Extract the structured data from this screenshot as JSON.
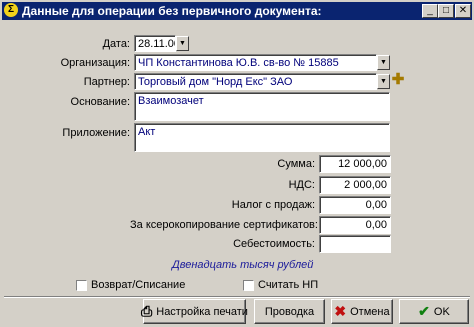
{
  "window": {
    "title": "Данные для операции без первичного документа:",
    "buttons": {
      "minimize": "_",
      "maximize": "□",
      "close": "✕"
    }
  },
  "form": {
    "date": {
      "label": "Дата:",
      "value": "28.11.00"
    },
    "organization": {
      "label": "Организация:",
      "value": "ЧП Константинова Ю.В. св-во № 15885"
    },
    "partner": {
      "label": "Партнер:",
      "value": "Торговый дом \"Норд Екс\" ЗАО"
    },
    "basis": {
      "label": "Основание:",
      "value": "Взаимозачет"
    },
    "attachment": {
      "label": "Приложение:",
      "value": "Акт"
    },
    "sum": {
      "label": "Сумма:",
      "value": "12 000,00"
    },
    "vat": {
      "label": "НДС:",
      "value": "2 000,00"
    },
    "sales_tax": {
      "label": "Налог с продаж:",
      "value": "0,00"
    },
    "copy_fee": {
      "label": "За ксерокопирование сертификатов:",
      "value": "0,00"
    },
    "cost": {
      "label": "Себестоимость:",
      "value": ""
    },
    "sum_in_words": "Двенадцать тысяч  рублей",
    "return_writeoff": {
      "label": "Возврат/Списание",
      "checked": false
    },
    "count_np": {
      "label": "Считать НП",
      "checked": false
    }
  },
  "buttons": {
    "print_settings": "Настройка печати",
    "post": "Проводка",
    "cancel": "Отмена",
    "ok": "OK"
  },
  "colors": {
    "titlebar": "#0a2470",
    "window_bg": "#d4d0c8",
    "field_text": "#00007a",
    "words_text": "#1a1a9a",
    "cancel_icon": "#c01010",
    "ok_icon": "#108010"
  }
}
